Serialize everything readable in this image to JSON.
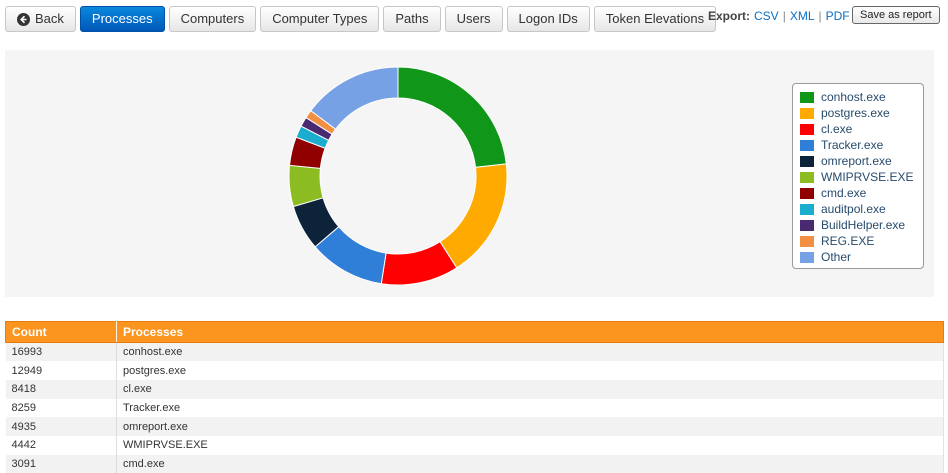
{
  "nav": {
    "back_label": "Back",
    "tabs": [
      "Processes",
      "Computers",
      "Computer Types",
      "Paths",
      "Users",
      "Logon IDs",
      "Token Elevations"
    ],
    "active_tab": "Processes"
  },
  "export": {
    "label": "Export:",
    "links": [
      "CSV",
      "XML",
      "PDF"
    ],
    "save_label": "Save as report",
    "link_color": "#0a6fc2"
  },
  "chart_data": {
    "type": "pie",
    "variant": "donut",
    "series": [
      {
        "name": "conhost.exe",
        "value": 16993,
        "color": "#109618"
      },
      {
        "name": "postgres.exe",
        "value": 12949,
        "color": "#ffaa00"
      },
      {
        "name": "cl.exe",
        "value": 8418,
        "color": "#ff0000"
      },
      {
        "name": "Tracker.exe",
        "value": 8259,
        "color": "#2f7ed8"
      },
      {
        "name": "omreport.exe",
        "value": 4935,
        "color": "#0d233a"
      },
      {
        "name": "WMIPRVSE.EXE",
        "value": 4442,
        "color": "#8bbc21"
      },
      {
        "name": "cmd.exe",
        "value": 3091,
        "color": "#910000"
      },
      {
        "name": "auditpol.exe",
        "value": 1300,
        "color": "#1aadce"
      },
      {
        "name": "BuildHelper.exe",
        "value": 1050,
        "color": "#492970"
      },
      {
        "name": "REG.EXE",
        "value": 900,
        "color": "#f28f43"
      },
      {
        "name": "Other",
        "value": 10800,
        "color": "#77a1e5"
      }
    ],
    "legend_position": "right"
  },
  "table": {
    "headers": [
      "Count",
      "Processes"
    ],
    "header_color": "#fb951f",
    "rows": [
      [
        "16993",
        "conhost.exe"
      ],
      [
        "12949",
        "postgres.exe"
      ],
      [
        "8418",
        "cl.exe"
      ],
      [
        "8259",
        "Tracker.exe"
      ],
      [
        "4935",
        "omreport.exe"
      ],
      [
        "4442",
        "WMIPRVSE.EXE"
      ],
      [
        "3091",
        "cmd.exe"
      ]
    ]
  }
}
